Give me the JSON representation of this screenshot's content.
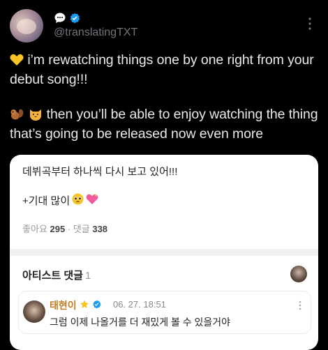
{
  "tweet": {
    "handle": "@translatingTXT",
    "line1": "i’m rewatching things one by one right from your debut song!!!",
    "line2": "then you’ll be able to enjoy watching the thing that’s going to be released now even more"
  },
  "card": {
    "post_text": "데뷔곡부터 하나씩 다시 보고 있어!!!",
    "post_text2": "+기대 많이",
    "likes_label": "좋아요",
    "likes_count": "295",
    "comments_label": "댓글",
    "comments_count": "338",
    "artist_header": "아티스트 댓글",
    "artist_count": "1",
    "reply": {
      "name": "태현이",
      "date": "06. 27. 18:51",
      "text": "그럼 이제 나올거를 더 재밌게 볼 수 있을거야"
    }
  },
  "colors": {
    "background": "#000000",
    "text": "#e7e9ea",
    "handle": "#71767b",
    "verified": "#1d9bf0",
    "reply_name": "#c47a20"
  },
  "icons": [
    "speech-bubble-icon",
    "verified-badge-icon",
    "more-icon",
    "yellow-heart-emoji",
    "chipmunk-emoji",
    "cat-emoji",
    "pleading-face-emoji",
    "sparkling-heart-emoji",
    "star-badge-icon"
  ]
}
